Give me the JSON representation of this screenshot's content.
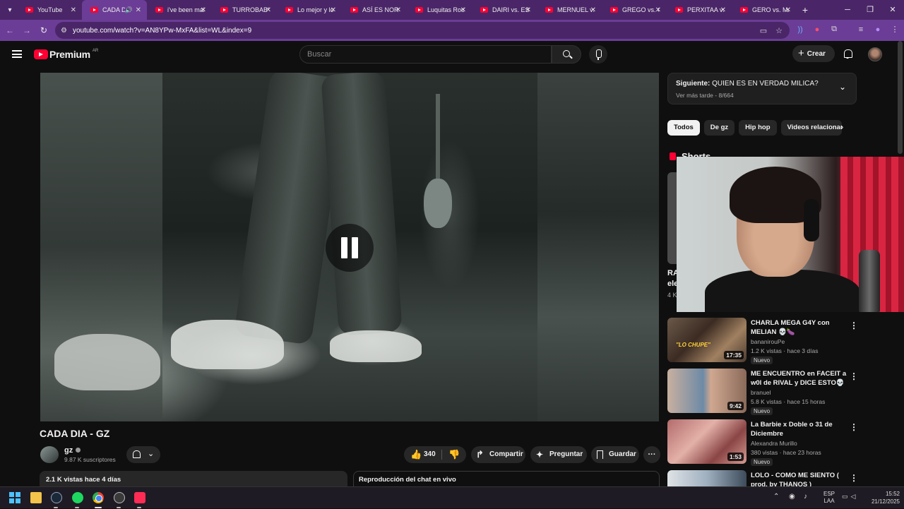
{
  "browser": {
    "tabs": [
      {
        "label": "YouTube",
        "active": false
      },
      {
        "label": "CADA DIA - GZ",
        "active": true,
        "audio": true
      },
      {
        "label": "i've been making",
        "active": false
      },
      {
        "label": "TURROBABY",
        "active": false
      },
      {
        "label": "Lo mejor y lo peor",
        "active": false
      },
      {
        "label": "ASÍ ES NORMAL",
        "active": false
      },
      {
        "label": "Luquitas Rodriguez",
        "active": false
      },
      {
        "label": "DAIRI vs. ESTE",
        "active": false
      },
      {
        "label": "MERNUEL vs.",
        "active": false
      },
      {
        "label": "GREGO vs. G",
        "active": false
      },
      {
        "label": "PERXITAA vs.",
        "active": false
      },
      {
        "label": "GERO vs. MA",
        "active": false
      }
    ],
    "url": "youtube.com/watch?v=AN8YPw-MxFA&list=WL&index=9"
  },
  "header": {
    "logo_text": "Premium",
    "country_code": "AR",
    "search_placeholder": "Buscar",
    "create_label": "Crear"
  },
  "video": {
    "title": "CADA DIA - GZ",
    "state": "paused-icon-visible",
    "channel": {
      "name": "gz",
      "subscribers": "9.87 K suscriptores"
    },
    "actions": {
      "like_count": "340",
      "share_label": "Compartir",
      "ask_label": "Preguntar",
      "save_label": "Guardar"
    },
    "description": "2.1 K vistas  hace 4 días",
    "chat_replay": "Reproducción del chat en vivo"
  },
  "sidebar": {
    "next": {
      "prefix": "Siguiente:",
      "title": "QUIEN ES EN VERDAD MILICA?",
      "subtitle": "Ver más tarde - 8/664"
    },
    "chips": [
      "Todos",
      "De gz",
      "Hip hop",
      "Videos relacionados"
    ],
    "shorts_heading": "Shorts",
    "shorts_fragment_1": "RA",
    "shorts_fragment_2": "ele",
    "shorts_fragment_3": "4 K",
    "recommendations": [
      {
        "title": "CHARLA MEGA G4Y con MELIAN 💀🍆",
        "channel": "bananirouPe",
        "meta": "1.2 K vistas · hace 3 días",
        "badge": "Nuevo",
        "duration": "17:35",
        "thumb_caption": "\"LO CHUPE\""
      },
      {
        "title": "ME ENCUENTRO en FACEIT a w0l de RIVAL y DICE ESTO💀",
        "channel": "branuel",
        "meta": "5.8 K vistas · hace 15 horas",
        "badge": "Nuevo",
        "duration": "9:42"
      },
      {
        "title": "La Barbie x Doble o 31 de Diciembre",
        "channel": "Alexandra Murillo",
        "meta": "380 vistas · hace 23 horas",
        "badge": "Nuevo",
        "duration": "1:53"
      },
      {
        "title": "LOLO - COMO ME SIENTO ( prod. by THANOS )",
        "channel": "",
        "meta": "",
        "badge": "",
        "duration": ""
      }
    ]
  },
  "taskbar": {
    "lang_1": "ESP",
    "lang_2": "LAA",
    "time": "15:52",
    "date": "21/12/2025"
  },
  "colors": {
    "browser_frame": "#4a2668",
    "browser_toolbar": "#6b3d96",
    "youtube_red": "#ff0033",
    "page_bg": "#0f0f0f"
  }
}
